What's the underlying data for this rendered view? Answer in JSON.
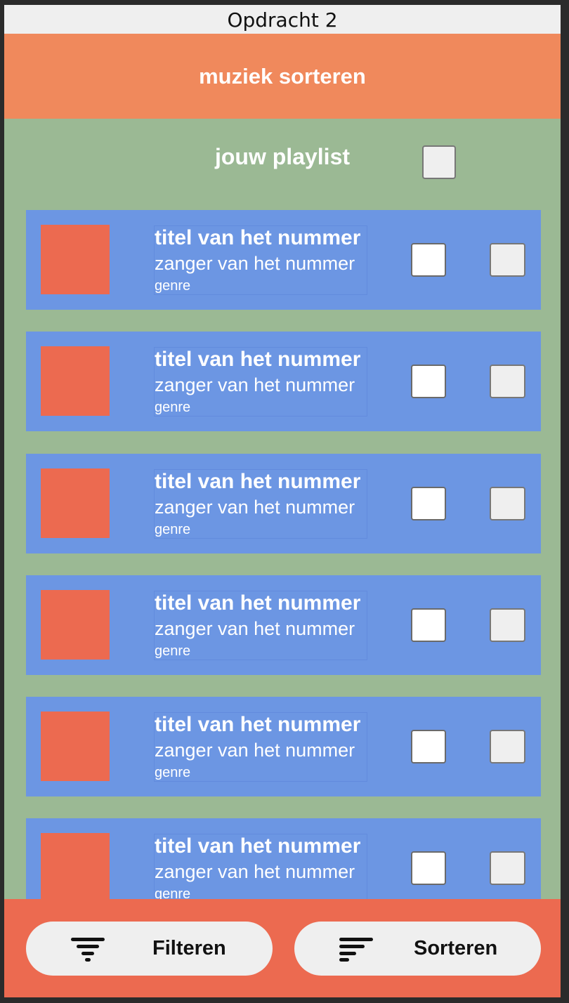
{
  "window": {
    "title": "Opdracht 2"
  },
  "header": {
    "title": "muziek sorteren"
  },
  "playlist": {
    "label": "jouw playlist"
  },
  "tracks": [
    {
      "title": "titel van het nummer",
      "artist": "zanger van het nummer",
      "genre": "genre"
    },
    {
      "title": "titel van het nummer",
      "artist": "zanger van het nummer",
      "genre": "genre"
    },
    {
      "title": "titel van het nummer",
      "artist": "zanger van het nummer",
      "genre": "genre"
    },
    {
      "title": "titel van het nummer",
      "artist": "zanger van het nummer",
      "genre": "genre"
    },
    {
      "title": "titel van het nummer",
      "artist": "zanger van het nummer",
      "genre": "genre"
    },
    {
      "title": "titel van het nummer",
      "artist": "zanger van het nummer",
      "genre": "genre"
    }
  ],
  "footer": {
    "filter_label": "Filteren",
    "filter_icon": "filter-icon",
    "sort_label": "Sorteren",
    "sort_icon": "sort-icon"
  },
  "colors": {
    "header": "#f0895c",
    "background": "#9bb994",
    "track_card": "#6c96e3",
    "cover": "#ec6a50",
    "footer": "#ec6a50"
  }
}
